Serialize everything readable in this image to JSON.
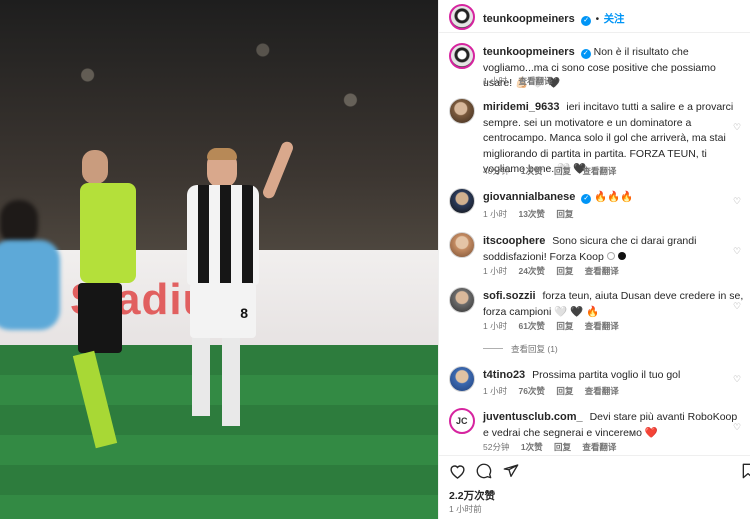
{
  "post_image": {
    "banner_text": "Stadium",
    "shorts_number": "8"
  },
  "header": {
    "username": "teunkoopmeiners",
    "separator": "•",
    "follow_label": "关注",
    "more_label": "…"
  },
  "comments": [
    {
      "username": "teunkoopmeiners",
      "text": "Non è il risultato che vogliamo...ma ci sono cose positive che possiamo usare!",
      "emoji": "💪🏻 🤍 🖤",
      "time": "1 小时",
      "translate": "查看翻译"
    },
    {
      "username": "miridemi_9633",
      "text": "ieri incitavo tutti a salire e a provarci sempre. sei un motivatore e un dominatore a centrocampo. Manca solo il gol che arriverà, ma stai migliorando di partita in partita. FORZA TEUN, ti vogliamo bene.",
      "emoji": "🤍 🖤",
      "time": "40分钟",
      "likes": "1次赞",
      "reply": "回复",
      "translate": "查看翻译"
    },
    {
      "username": "giovannialbanese",
      "text": "🔥🔥🔥",
      "time": "1 小时",
      "likes": "13次赞",
      "reply": "回复"
    },
    {
      "username": "itscoophere",
      "text": "Sono sicura che ci darai grandi soddisfazioni! Forza Koop",
      "time": "1 小时",
      "likes": "24次赞",
      "reply": "回复",
      "translate": "查看翻译"
    },
    {
      "username": "sofi.sozzii",
      "text": "forza teun, aiuta Dusan deve credere in se, forza campioni",
      "emoji": "🤍 🖤 🔥",
      "time": "1 小时",
      "likes": "61次赞",
      "reply": "回复",
      "translate": "查看翻译",
      "view_replies": "查看回复 (1)"
    },
    {
      "username": "t4tino23",
      "text": "Prossima partita voglio il tuo gol",
      "time": "1 小时",
      "likes": "76次赞",
      "reply": "回复",
      "translate": "查看翻译"
    },
    {
      "username": "juventusclub.com_",
      "text": "Devi stare più avanti RoboKoop e vedrai che segnerai e vincereмо",
      "emoji": "❤️",
      "time": "52分钟",
      "likes": "1次赞",
      "reply": "回复",
      "translate": "查看翻译"
    }
  ],
  "footer": {
    "likes": "2.2万次赞",
    "posted": "1 小时前"
  },
  "icons": [
    "heart-icon",
    "comment-icon",
    "share-icon",
    "bookmark-icon",
    "verified-icon",
    "like-comment-icon"
  ],
  "colors": {
    "link_blue": "#0095f6",
    "verified_blue": "#0095f6",
    "muted": "#737373"
  }
}
